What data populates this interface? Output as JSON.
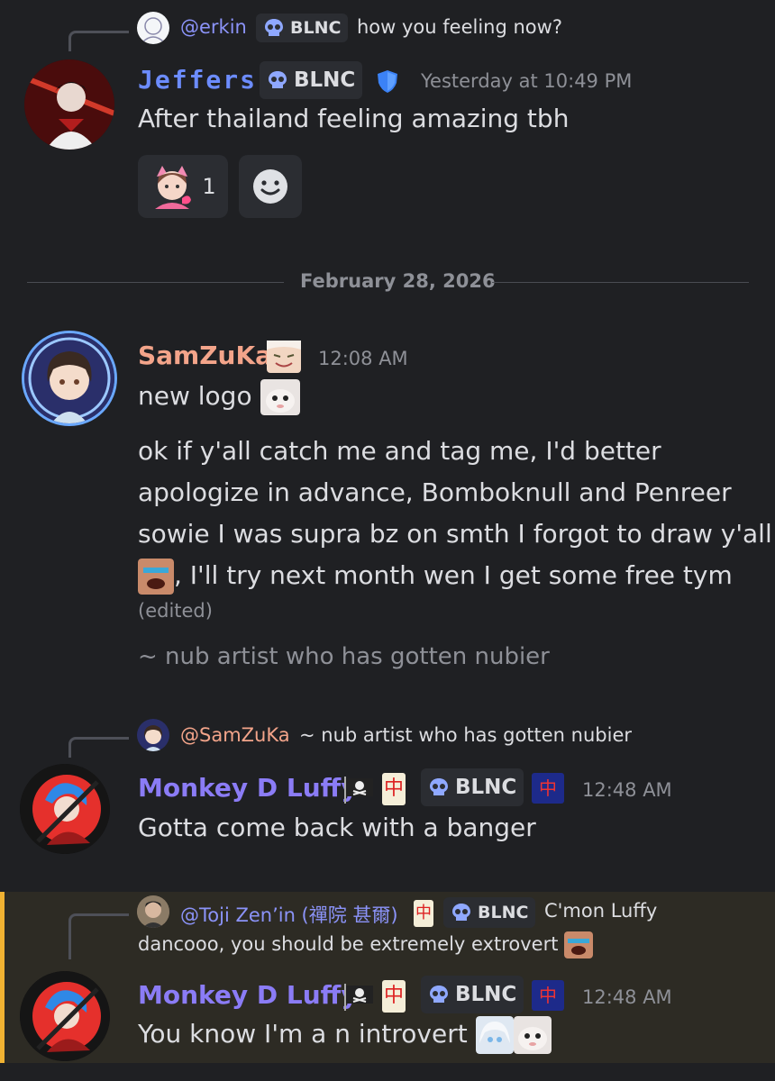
{
  "msg1": {
    "reply": {
      "mention": "@erkin",
      "tag": "BLNC",
      "text": "how you feeling now?"
    },
    "author": "Jeffers",
    "author_color": "#6c8cff",
    "tag": "BLNC",
    "time": "Yesterday at 10:49 PM",
    "text": "After thailand feeling amazing tbh",
    "reactions": [
      {
        "icon": "pink-cat-girl-emoji",
        "count": "1"
      }
    ]
  },
  "divider": {
    "date": "February 28, 2026"
  },
  "msg2": {
    "author": "SamZuKa",
    "author_color": "#f3a48a",
    "time": "12:08 AM",
    "line1": "new logo",
    "para_lines": [
      "ok if y'all catch me and tag me, I'd better",
      "apologize in advance, Bomboknull and Penreer",
      "sowie I was supra bz on smth I forgot to draw y'all",
      ", I'll try next month wen I get some free tym"
    ],
    "edited": "(edited)",
    "signature": "~ nub artist who has gotten nubier"
  },
  "msg3": {
    "reply": {
      "mention": "@SamZuKa",
      "text": "~ nub artist who has gotten nubier"
    },
    "author": "Monkey D Luffy",
    "author_color": "#8b7cf6",
    "tag": "BLNC",
    "time": "12:48 AM",
    "text": "Gotta come back with a banger"
  },
  "msg4": {
    "reply": {
      "mention": "@Toji Zen’in (禪院 甚爾)",
      "tag": "BLNC",
      "text_line1": "C'mon Luffy",
      "text_line2": "dancooo, you should be extremely extrovert"
    },
    "author": "Monkey D Luffy",
    "author_color": "#8b7cf6",
    "tag": "BLNC",
    "time": "12:48 AM",
    "text": "You know I'm a n introvert",
    "highlight_color": "#f0b232"
  },
  "glyphs": {
    "mahjong": "中",
    "smile": "☻"
  }
}
